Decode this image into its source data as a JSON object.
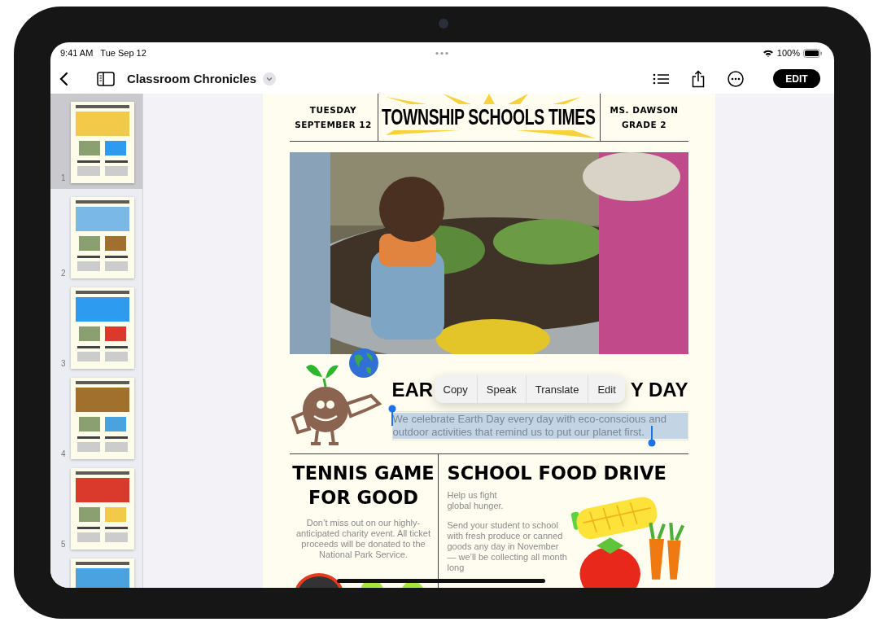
{
  "status_bar": {
    "time": "9:41 AM",
    "date": "Tue Sep 12",
    "battery": "100%"
  },
  "toolbar": {
    "title": "Classroom Chronicles",
    "edit_button": "EDIT"
  },
  "sidebar": {
    "pages": [
      {
        "number": "1",
        "selected": true
      },
      {
        "number": "2",
        "selected": false
      },
      {
        "number": "3",
        "selected": false
      },
      {
        "number": "4",
        "selected": false
      },
      {
        "number": "5",
        "selected": false
      },
      {
        "selected": false
      }
    ]
  },
  "page": {
    "masthead": {
      "day": "TUESDAY",
      "date": "SEPTEMBER 12",
      "title": "TOWNSHIP SCHOOLS TIMES",
      "teacher": "MS. DAWSON",
      "grade": "GRADE 2"
    },
    "earth_day": {
      "heading_visible_left": "EAR",
      "heading_visible_right": "Y DAY",
      "paragraph": "We celebrate Earth Day every day with eco-conscious and outdoor activities that remind us to put our planet first.",
      "selected": true
    },
    "context_menu": [
      "Copy",
      "Speak",
      "Translate",
      "Edit"
    ],
    "tennis": {
      "heading": "TENNIS GAME FOR GOOD",
      "body": "Don’t miss out on our highly-anticipated charity event. All ticket proceeds will be donated to the National Park Service."
    },
    "food_drive": {
      "heading": "SCHOOL FOOD DRIVE",
      "paragraphs": [
        "Help us fight\nglobal hunger.",
        "Send your student to school with fresh produce or canned goods any day in November — we’ll be collecting all month long"
      ]
    }
  }
}
